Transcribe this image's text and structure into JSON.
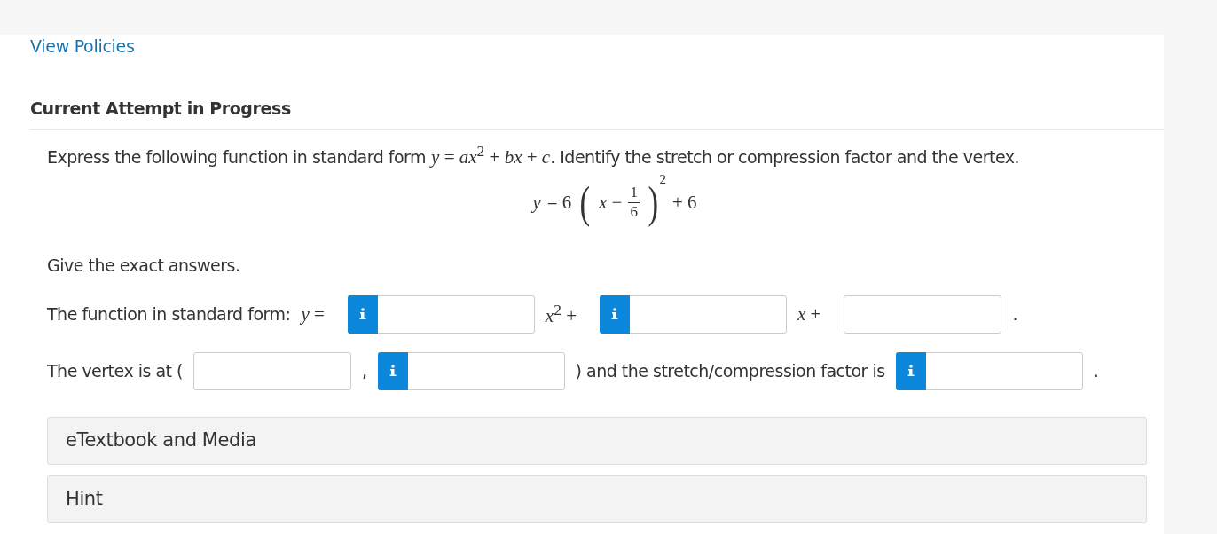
{
  "policies_link": "View Policies",
  "attempt_heading": "Current Attempt in Progress",
  "question": {
    "prompt": [
      {
        "kind": "text",
        "text": "Express the following function in standard form"
      },
      {
        "kind": "math",
        "text": "*y* = *ax*$^{2}$ + *bx* + *c*"
      },
      {
        "kind": "text",
        "text": ". Identify the stretch or compression factor and the vertex."
      }
    ],
    "equation": {
      "lhs": "y",
      "equals": "= 6",
      "open_paren": "(",
      "inner": "x −",
      "numerator": "1",
      "denominator": "6",
      "close_paren": ")",
      "exponent": "2",
      "tail": "+ 6"
    },
    "instruction": "Give the exact answers.",
    "answer_rows": [
      [
        {
          "kind": "text",
          "text": "The function in standard form:"
        },
        {
          "kind": "math",
          "text": "*y* ="
        },
        {
          "kind": "input",
          "info_button": true
        },
        {
          "kind": "math",
          "text": "*x*$^{2}$ +"
        },
        {
          "kind": "input",
          "info_button": true
        },
        {
          "kind": "math",
          "text": "*x* +"
        },
        {
          "kind": "input",
          "info_button": false
        },
        {
          "kind": "text",
          "text": "."
        }
      ],
      [
        {
          "kind": "text",
          "text": "The vertex is at ("
        },
        {
          "kind": "input",
          "info_button": false
        },
        {
          "kind": "text",
          "text": ","
        },
        {
          "kind": "input",
          "info_button": true
        },
        {
          "kind": "text",
          "text": ") and the stretch/compression factor is"
        },
        {
          "kind": "input",
          "info_button": true
        },
        {
          "kind": "text",
          "text": "."
        }
      ]
    ]
  },
  "panels": [
    {
      "title": "eTextbook and Media",
      "expanded": false
    },
    {
      "title": "Hint",
      "expanded": false
    }
  ]
}
